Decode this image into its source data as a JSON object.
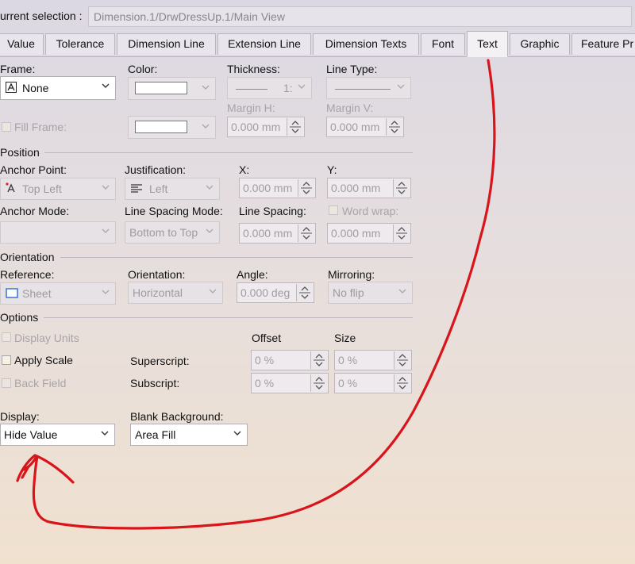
{
  "selection": {
    "label": "urrent selection :",
    "value": "Dimension.1/DrwDressUp.1/Main View"
  },
  "tabs": [
    {
      "label": "Value"
    },
    {
      "label": "Tolerance"
    },
    {
      "label": "Dimension Line"
    },
    {
      "label": "Extension Line"
    },
    {
      "label": "Dimension Texts"
    },
    {
      "label": "Font"
    },
    {
      "label": "Text",
      "active": true
    },
    {
      "label": "Graphic"
    },
    {
      "label": "Feature Pr"
    }
  ],
  "frame": {
    "frame_label": "Frame:",
    "frame_value": "None",
    "color_label": "Color:",
    "thickness_label": "Thickness:",
    "thickness_value": "1:",
    "linetype_label": "Line Type:",
    "fill_frame_label": "Fill Frame:",
    "margin_h_label": "Margin H:",
    "margin_h_value": "0.000 mm",
    "margin_v_label": "Margin V:",
    "margin_v_value": "0.000 mm"
  },
  "position": {
    "section": "Position",
    "anchor_point_label": "Anchor Point:",
    "anchor_point_value": "Top Left",
    "justification_label": "Justification:",
    "justification_value": "Left",
    "x_label": "X:",
    "x_value": "0.000 mm",
    "y_label": "Y:",
    "y_value": "0.000 mm",
    "anchor_mode_label": "Anchor Mode:",
    "anchor_mode_value": "",
    "line_spacing_mode_label": "Line Spacing Mode:",
    "line_spacing_mode_value": "Bottom to Top",
    "line_spacing_label": "Line Spacing:",
    "line_spacing_value": "0.000 mm",
    "word_wrap_label": "Word wrap:",
    "word_wrap_value": "0.000 mm"
  },
  "orientation": {
    "section": "Orientation",
    "reference_label": "Reference:",
    "reference_value": "Sheet",
    "orientation_label": "Orientation:",
    "orientation_value": "Horizontal",
    "angle_label": "Angle:",
    "angle_value": "0.000 deg",
    "mirroring_label": "Mirroring:",
    "mirroring_value": "No flip"
  },
  "options": {
    "section": "Options",
    "display_units_label": "Display Units",
    "apply_scale_label": "Apply Scale",
    "back_field_label": "Back Field",
    "offset_header": "Offset",
    "size_header": "Size",
    "superscript_label": "Superscript:",
    "superscript_offset": "0 %",
    "superscript_size": "0 %",
    "subscript_label": "Subscript:",
    "subscript_offset": "0 %",
    "subscript_size": "0 %"
  },
  "display": {
    "display_label": "Display:",
    "display_value": "Hide Value",
    "blank_bg_label": "Blank Background:",
    "blank_bg_value": "Area Fill"
  },
  "colors": {
    "annotation": "#d8151b"
  }
}
